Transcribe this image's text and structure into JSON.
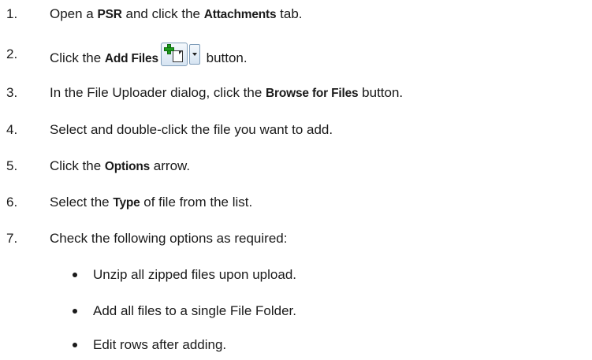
{
  "steps": [
    {
      "number": "1.",
      "p1": "Open a ",
      "k1": "PSR",
      "p2": " and click the ",
      "k2": "Attachments",
      "p3": " tab."
    },
    {
      "number": "2.",
      "p1": "Click the ",
      "k1": "Add Files",
      "p2": " button."
    },
    {
      "number": "3.",
      "p1": "In the File Uploader dialog, click the ",
      "k1": "Browse for Files",
      "p2": " button."
    },
    {
      "number": "4.",
      "p1": "Select and double-click the file you want to add."
    },
    {
      "number": "5.",
      "p1": "Click the ",
      "k1": "Options",
      "p2": " arrow."
    },
    {
      "number": "6.",
      "p1": "Select the ",
      "k1": "Type",
      "p2": " of file from the list."
    },
    {
      "number": "7.",
      "p1": "Check the following options as required:"
    }
  ],
  "options": [
    "Unzip all zipped files upon upload.",
    "Add all files to a single File Folder.",
    "Edit rows after adding."
  ],
  "icons": {
    "add_files_button": "add-file-icon",
    "dropdown": "chevron-down-icon"
  }
}
